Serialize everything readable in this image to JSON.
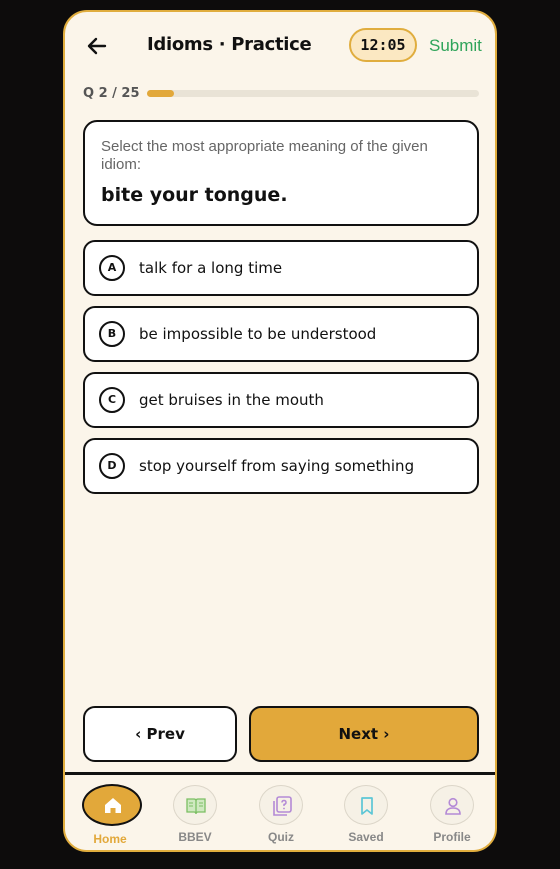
{
  "header": {
    "title": "Idioms · Practice",
    "timer": "12:05",
    "submit_label": "Submit",
    "back_icon": "arrow-left-icon"
  },
  "progress": {
    "label": "Q 2 / 25",
    "current": 2,
    "total": 25,
    "fraction": 0.08
  },
  "question": {
    "prompt": "Select the most appropriate meaning of the given idiom:",
    "idiom": "bite your tongue."
  },
  "options": [
    {
      "letter": "A",
      "text": "talk for a long time"
    },
    {
      "letter": "B",
      "text": "be impossible to be understood"
    },
    {
      "letter": "C",
      "text": "get bruises in the mouth"
    },
    {
      "letter": "D",
      "text": "stop yourself from saying something"
    }
  ],
  "nav": {
    "prev_label": "‹ Prev",
    "next_label": "Next ›"
  },
  "tabs": [
    {
      "label": "Home",
      "icon": "home-icon",
      "active": true
    },
    {
      "label": "BBEV",
      "icon": "book-icon",
      "active": false
    },
    {
      "label": "Quiz",
      "icon": "quiz-icon",
      "active": false
    },
    {
      "label": "Saved",
      "icon": "bookmark-icon",
      "active": false
    },
    {
      "label": "Profile",
      "icon": "user-icon",
      "active": false
    }
  ],
  "colors": {
    "accent": "#e2a83a",
    "background": "#fbf5ea",
    "submit": "#2fa45a"
  }
}
